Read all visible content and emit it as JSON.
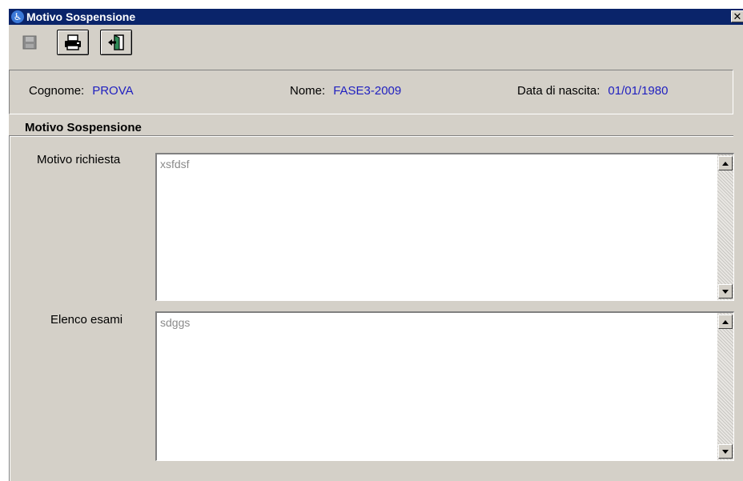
{
  "window": {
    "title": "Motivo Sospensione",
    "close_glyph": "✕"
  },
  "toolbar": {
    "buttons": [
      {
        "icon": "save-icon",
        "enabled": false
      },
      {
        "icon": "print-icon",
        "enabled": true
      },
      {
        "icon": "exit-icon",
        "enabled": true
      }
    ]
  },
  "patient": {
    "cognome_label": "Cognome:",
    "cognome_value": "PROVA",
    "nome_label": "Nome:",
    "nome_value": "FASE3-2009",
    "nascita_label": "Data di nascita:",
    "nascita_value": "01/01/1980"
  },
  "group": {
    "title": "Motivo Sospensione",
    "motivo_label": "Motivo richiesta",
    "motivo_value": "xsfdsf",
    "esami_label": "Elenco esami",
    "esami_value": "sdggs"
  },
  "colors": {
    "titlebar": "#0a246a",
    "face": "#d4d0c8",
    "value_text": "#2020c0"
  }
}
